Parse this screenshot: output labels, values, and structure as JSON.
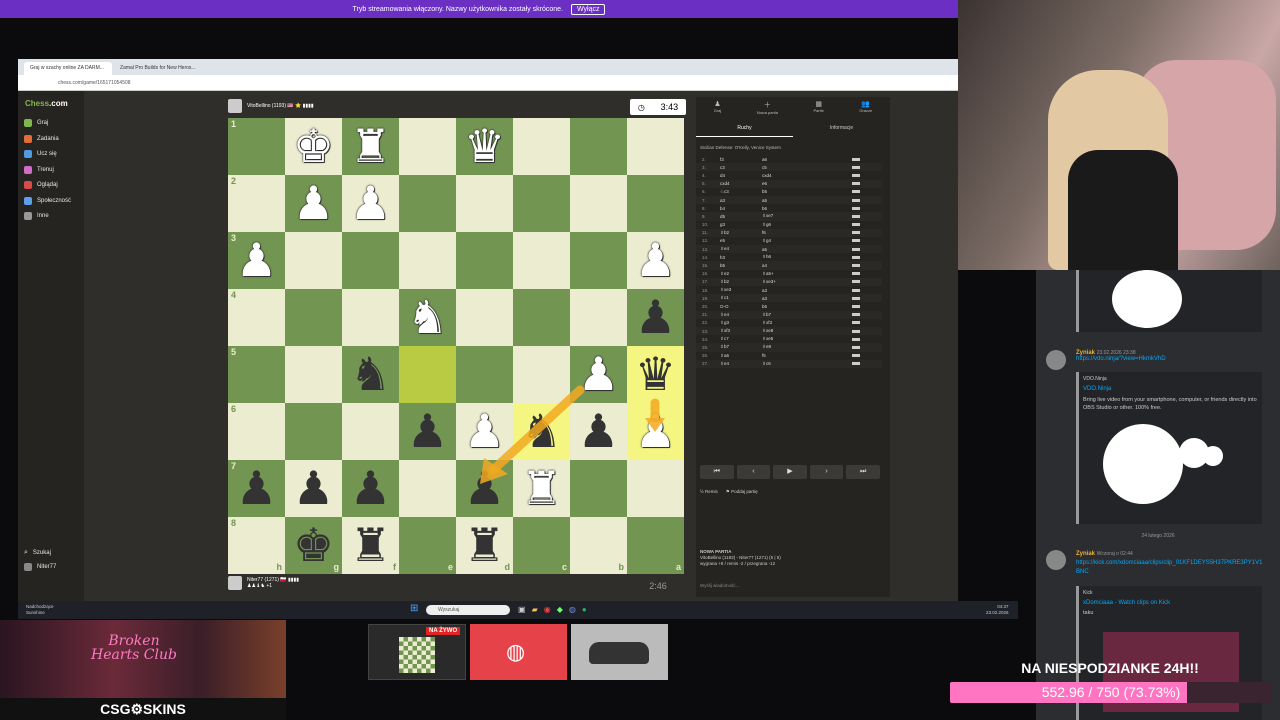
{
  "stream_notice": {
    "text": "Tryb streamowania włączony. Nazwy użytkownika zostały skrócone.",
    "button": "Wyłącz"
  },
  "browser": {
    "tabs": [
      "Graj w szachy online ZA DARM...",
      "Zamal Pro Builds for New Heros..."
    ],
    "url": "chess.com/game/165171054508"
  },
  "chesscom": {
    "logo_a": "Chess",
    "logo_b": ".com",
    "nav": [
      {
        "label": "Graj",
        "icon": "pawn-icon",
        "color": "#81b64c"
      },
      {
        "label": "Zadania",
        "icon": "puzzle-icon",
        "color": "#e36c3a"
      },
      {
        "label": "Ucz się",
        "icon": "learn-icon",
        "color": "#4f9be0"
      },
      {
        "label": "Trenuj",
        "icon": "train-icon",
        "color": "#d16cc9"
      },
      {
        "label": "Oglądaj",
        "icon": "watch-icon",
        "color": "#d94b4b"
      },
      {
        "label": "Społeczność",
        "icon": "community-icon",
        "color": "#5ba0e8"
      },
      {
        "label": "Inne",
        "icon": "more-icon",
        "color": "#999999"
      }
    ],
    "search": "Szukaj",
    "me": "Niter77"
  },
  "game": {
    "top_player": "VitoBellino (1193) 🇺🇸 ⭐ ▮▮▮▮",
    "top_clock": "3:43",
    "bottom_player": "Niter77 (1271) 🇵🇱 ▮▮▮▮",
    "bottom_clock": "2:46",
    "captured": "♟♟♝♞ +1",
    "ranks": [
      "1",
      "2",
      "3",
      "4",
      "5",
      "6",
      "7",
      "8"
    ],
    "files": [
      "h",
      "g",
      "f",
      "e",
      "d",
      "c",
      "b",
      "a"
    ],
    "board": [
      [
        "",
        "♚w",
        "♜w",
        "",
        "♛w",
        "",
        "",
        ""
      ],
      [
        "",
        "♟w",
        "♟w",
        "",
        "",
        "",
        "",
        ""
      ],
      [
        "♟w",
        "",
        "",
        "",
        "",
        "",
        "",
        "♟w"
      ],
      [
        "",
        "",
        "",
        "♞w",
        "",
        "",
        "",
        "♟b"
      ],
      [
        "",
        "",
        "♞b",
        "",
        "",
        "",
        "♟w",
        "♛b"
      ],
      [
        "",
        "",
        "",
        "♟b",
        "♟w",
        "♞b",
        "♟b",
        "♟w"
      ],
      [
        "♟b",
        "♟b",
        "♟b",
        "",
        "♟b",
        "♜w",
        "",
        ""
      ],
      [
        "",
        "♚b",
        "♜b",
        "",
        "♜b",
        "",
        "",
        ""
      ]
    ]
  },
  "panel": {
    "tabs": [
      {
        "icon": "♟",
        "label": "Graj"
      },
      {
        "icon": "＋",
        "label": "Nowa partia"
      },
      {
        "icon": "▦",
        "label": "Partie"
      },
      {
        "icon": "👥",
        "label": "Gracze"
      }
    ],
    "subtabs": [
      "Ruchy",
      "Informacje"
    ],
    "opening": "Sicilian Defense: O'Kelly, Venice System",
    "moves": [
      [
        "2.",
        "f3",
        "a6"
      ],
      [
        "3.",
        "c3",
        "c5"
      ],
      [
        "4.",
        "d4",
        "cxd4"
      ],
      [
        "5.",
        "cxd4",
        "e6"
      ],
      [
        "6.",
        "♘c3",
        "b5"
      ],
      [
        "7.",
        "a3",
        "a5"
      ],
      [
        "8.",
        "b4",
        "b6"
      ],
      [
        "9.",
        "d5",
        "♗xe7"
      ],
      [
        "10.",
        "g3",
        "♗g6"
      ],
      [
        "11.",
        "♗b2",
        "f6"
      ],
      [
        "12.",
        "e5",
        "♗g4"
      ],
      [
        "13.",
        "♗e4",
        "a5"
      ],
      [
        "14.",
        "h3",
        "♗h6"
      ],
      [
        "15.",
        "b5",
        "a4"
      ],
      [
        "16.",
        "♗e2",
        "♗a5+"
      ],
      [
        "17.",
        "♗b2",
        "♗xe3+"
      ],
      [
        "18.",
        "♗xe3",
        "a3"
      ],
      [
        "19.",
        "♗c1",
        "a3"
      ],
      [
        "20.",
        "O-O",
        "b6"
      ],
      [
        "21.",
        "♗e4",
        "♗b7"
      ],
      [
        "22.",
        "♗g3",
        "♗xf3"
      ],
      [
        "23.",
        "♗xf3",
        "♗xe8"
      ],
      [
        "24.",
        "♗c7",
        "♗xe5"
      ],
      [
        "25.",
        "♗b7",
        "♗e8"
      ],
      [
        "26.",
        "♗a6",
        "f5"
      ],
      [
        "27.",
        "♗e4",
        "♗c6"
      ]
    ],
    "nav": [
      "⏮",
      "‹",
      "▶",
      "›",
      "⏭"
    ],
    "draw": "Remis",
    "resign": "Poddaj partię",
    "new_game_title": "NOWA PARTIA",
    "new_game_line1": "VitoBellino (1193) - Niter77 (1271) (5 | 5)",
    "new_game_line2": "wygrana +8 / remis -2 / przegrana -12",
    "chat_placeholder": "Wyślij wiadomość..."
  },
  "taskbar": {
    "search": "Wyszukaj",
    "weather": "Nadchodzące",
    "weather2": "Sunshine",
    "time": "04:37",
    "date": "23.02.2026"
  },
  "discord": {
    "messages": [
      {
        "name": "Zyniak",
        "time": "23.02.2026 23:38",
        "link": "https://vdo.ninja/?view=HkmkVhD",
        "embed_site": "VDO.Ninja",
        "embed_title": "VDO.Ninja",
        "embed_desc": "Bring live video from your smartphone, computer, or friends directly into OBS Studio or other. 100% free."
      },
      {
        "name": "Zyniak",
        "time": "Wczoraj o 02:44",
        "link": "https://kick.com/xdomciaaa/clips/clip_01KF1DEYS5H37PKRE3PY1V1BNC",
        "embed_site": "Kick",
        "embed_title": "xDomciaaa - Watch clips on Kick",
        "embed_desc": "taku"
      }
    ],
    "date_separator": "24 lutego 2026"
  },
  "overlay": {
    "broken_hearts": "Broken Hearts Club",
    "csgo": "CSG⚙SKINS",
    "live": "NA ŻYWO",
    "goal_label": "NA NIESPODZIANKE 24H!!",
    "goal_text": "552.96 / 750 (73.73%)",
    "goal_fraction": 0.7373,
    "goal_color": "#ff75c2"
  }
}
